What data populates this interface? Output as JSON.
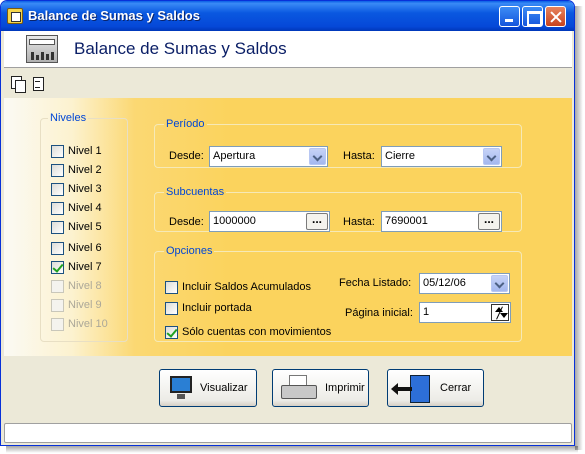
{
  "window": {
    "title": "Balance de Sumas y Saldos"
  },
  "header": {
    "title": "Balance de Sumas y Saldos"
  },
  "toolbar": {
    "icons": [
      "copy-icon",
      "document-icon"
    ]
  },
  "niveles": {
    "legend": "Niveles",
    "items": [
      {
        "label": "Nivel 1",
        "checked": false,
        "enabled": true
      },
      {
        "label": "Nivel 2",
        "checked": false,
        "enabled": true
      },
      {
        "label": "Nivel 3",
        "checked": false,
        "enabled": true
      },
      {
        "label": "Nivel 4",
        "checked": false,
        "enabled": true
      },
      {
        "label": "Nivel 5",
        "checked": false,
        "enabled": true
      },
      {
        "label": "Nivel 6",
        "checked": false,
        "enabled": true
      },
      {
        "label": "Nivel 7",
        "checked": true,
        "enabled": true
      },
      {
        "label": "Nivel 8",
        "checked": false,
        "enabled": false
      },
      {
        "label": "Nivel 9",
        "checked": false,
        "enabled": false
      },
      {
        "label": "Nivel 10",
        "checked": false,
        "enabled": false
      }
    ]
  },
  "periodo": {
    "legend": "Período",
    "desde_label": "Desde:",
    "desde_value": "Apertura",
    "hasta_label": "Hasta:",
    "hasta_value": "Cierre"
  },
  "subcuentas": {
    "legend": "Subcuentas",
    "desde_label": "Desde:",
    "desde_value": "1000000",
    "hasta_label": "Hasta:",
    "hasta_value": "7690001",
    "browse_label": "..."
  },
  "opciones": {
    "legend": "Opciones",
    "incluir_saldos_label": "Incluir Saldos Acumulados",
    "incluir_saldos_checked": false,
    "incluir_portada_label": "Incluir portada",
    "incluir_portada_checked": false,
    "solo_movimientos_label": "Sólo cuentas con movimientos",
    "solo_movimientos_checked": true,
    "fecha_label": "Fecha Listado:",
    "fecha_value": "05/12/06",
    "pagina_label": "Página inicial:",
    "pagina_value": "1"
  },
  "buttons": {
    "visualizar": "Visualizar",
    "imprimir": "Imprimir",
    "cerrar": "Cerrar"
  },
  "colors": {
    "titlebar": "#0548d8",
    "accent_panel": "#fbd35d",
    "legend_text": "#0046d5"
  }
}
